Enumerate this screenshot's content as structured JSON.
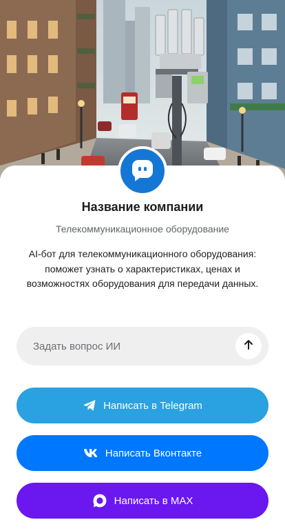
{
  "hero": {
    "image": "city-street-telecom-tower-illustration"
  },
  "profile": {
    "avatar_icon": "chat-bot-icon",
    "name": "Название компании",
    "subtitle": "Телекоммуникационное оборудование",
    "description": "AI-бот для телекоммуникационного оборудования: поможет узнать о характеристиках, ценах и возможностях оборудования для передачи данных."
  },
  "ask": {
    "placeholder": "Задать вопрос ИИ",
    "send_icon": "arrow-up-icon"
  },
  "buttons": {
    "telegram": {
      "label": "Написать в Telegram",
      "icon": "telegram-icon",
      "color": "#2aa1e0"
    },
    "vk": {
      "label": "Написать Вконтакте",
      "icon": "vk-icon",
      "color": "#0077ff"
    },
    "max": {
      "label": "Написать в MAX",
      "icon": "max-icon",
      "color": "#6a17f0"
    }
  },
  "colors": {
    "accent": "#1477d6"
  }
}
